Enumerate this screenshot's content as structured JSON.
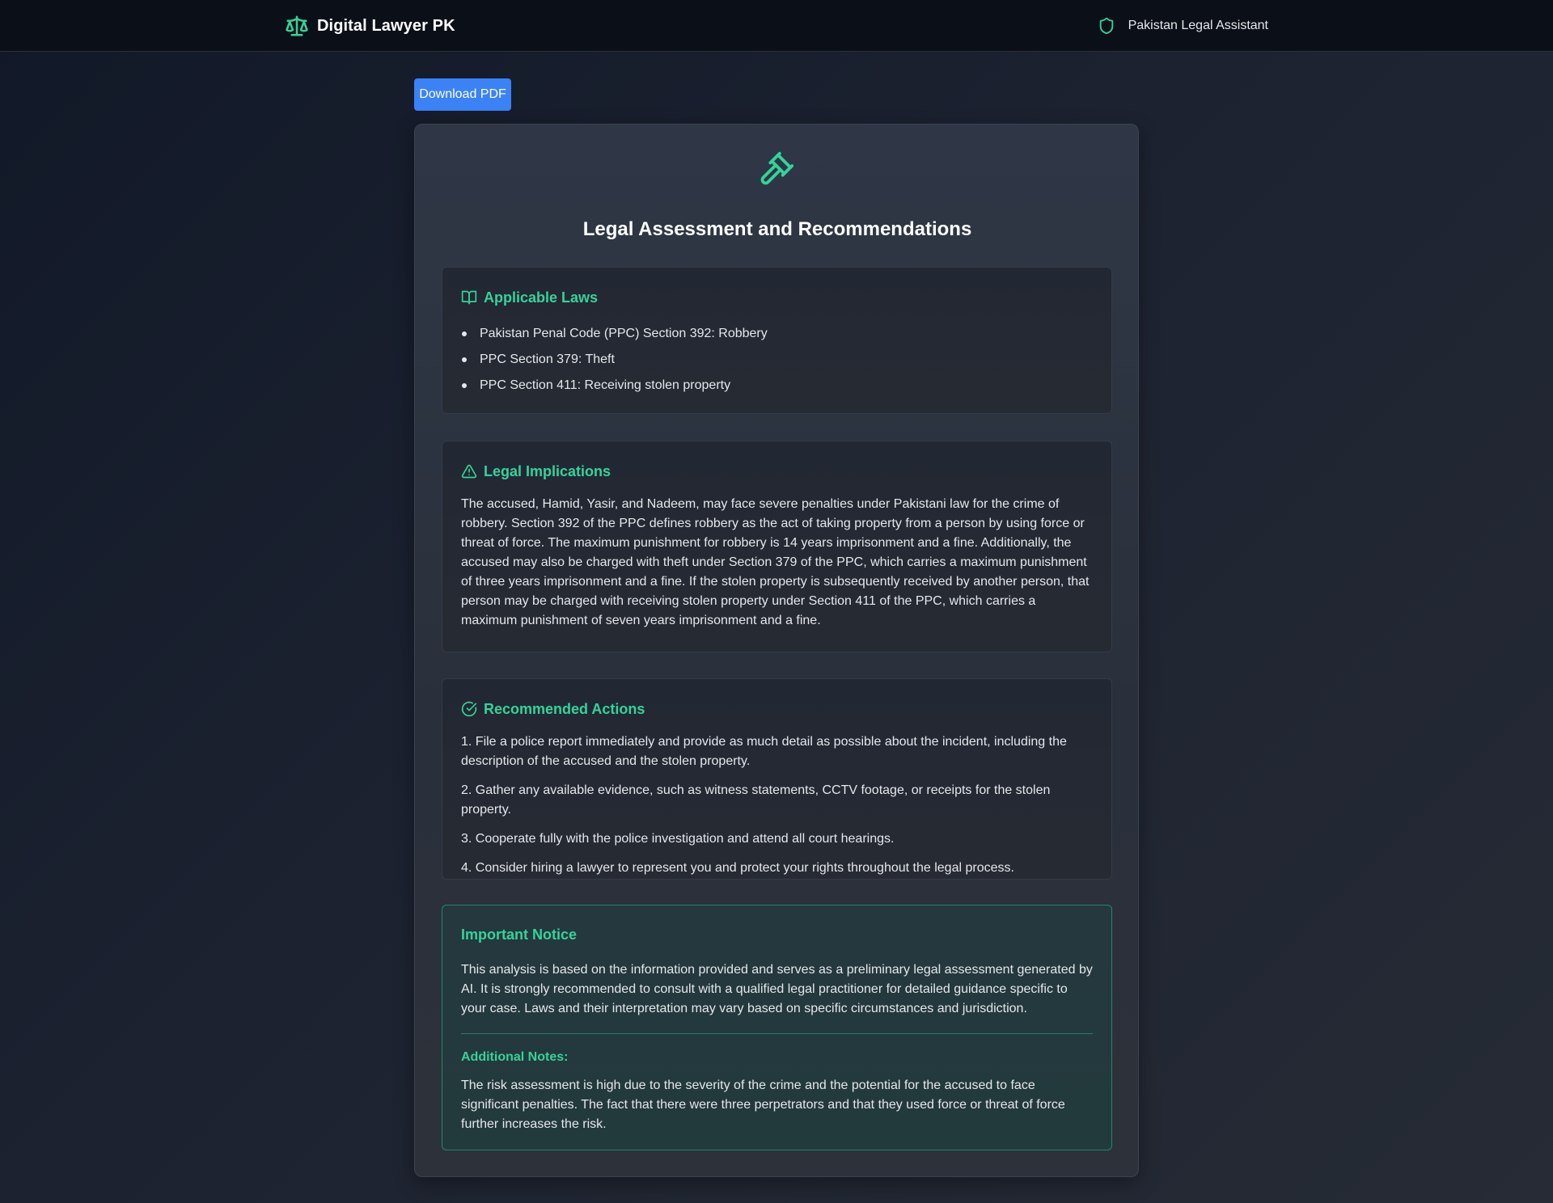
{
  "header": {
    "brand_name": "Digital Lawyer PK",
    "brand_icon": "scale-icon",
    "tagline": "Pakistan Legal Assistant",
    "tagline_icon": "shield-icon"
  },
  "toolbar": {
    "download_label": "Download PDF"
  },
  "report": {
    "icon": "gavel-icon",
    "title": "Legal Assessment and Recommendations",
    "applicable_laws": {
      "icon": "book-open-icon",
      "title": "Applicable Laws",
      "items": [
        "Pakistan Penal Code (PPC) Section 392: Robbery",
        "PPC Section 379: Theft",
        "PPC Section 411: Receiving stolen property"
      ]
    },
    "legal_implications": {
      "icon": "warning-triangle-icon",
      "title": "Legal Implications",
      "text": "The accused, Hamid, Yasir, and Nadeem, may face severe penalties under Pakistani law for the crime of robbery. Section 392 of the PPC defines robbery as the act of taking property from a person by using force or threat of force. The maximum punishment for robbery is 14 years imprisonment and a fine. Additionally, the accused may also be charged with theft under Section 379 of the PPC, which carries a maximum punishment of three years imprisonment and a fine. If the stolen property is subsequently received by another person, that person may be charged with receiving stolen property under Section 411 of the PPC, which carries a maximum punishment of seven years imprisonment and a fine."
    },
    "recommended_actions": {
      "icon": "check-circle-icon",
      "title": "Recommended Actions",
      "items": [
        "1. File a police report immediately and provide as much detail as possible about the incident, including the description of the accused and the stolen property.",
        "2. Gather any available evidence, such as witness statements, CCTV footage, or receipts for the stolen property.",
        "3. Cooperate fully with the police investigation and attend all court hearings.",
        "4. Consider hiring a lawyer to represent you and protect your rights throughout the legal process."
      ]
    },
    "notice": {
      "title": "Important Notice",
      "text": "This analysis is based on the information provided and serves as a preliminary legal assessment generated by AI. It is strongly recommended to consult with a qualified legal practitioner for detailed guidance specific to your case. Laws and their interpretation may vary based on specific circumstances and jurisdiction.",
      "notes_label": "Additional Notes:",
      "notes_text": "The risk assessment is high due to the severity of the crime and the potential for the accused to face significant penalties. The fact that there were three perpetrators and that they used force or threat of force further increases the risk."
    }
  },
  "colors": {
    "accent": "#34d399",
    "button": "#3b82f6",
    "header_bg": "#0b1018"
  }
}
